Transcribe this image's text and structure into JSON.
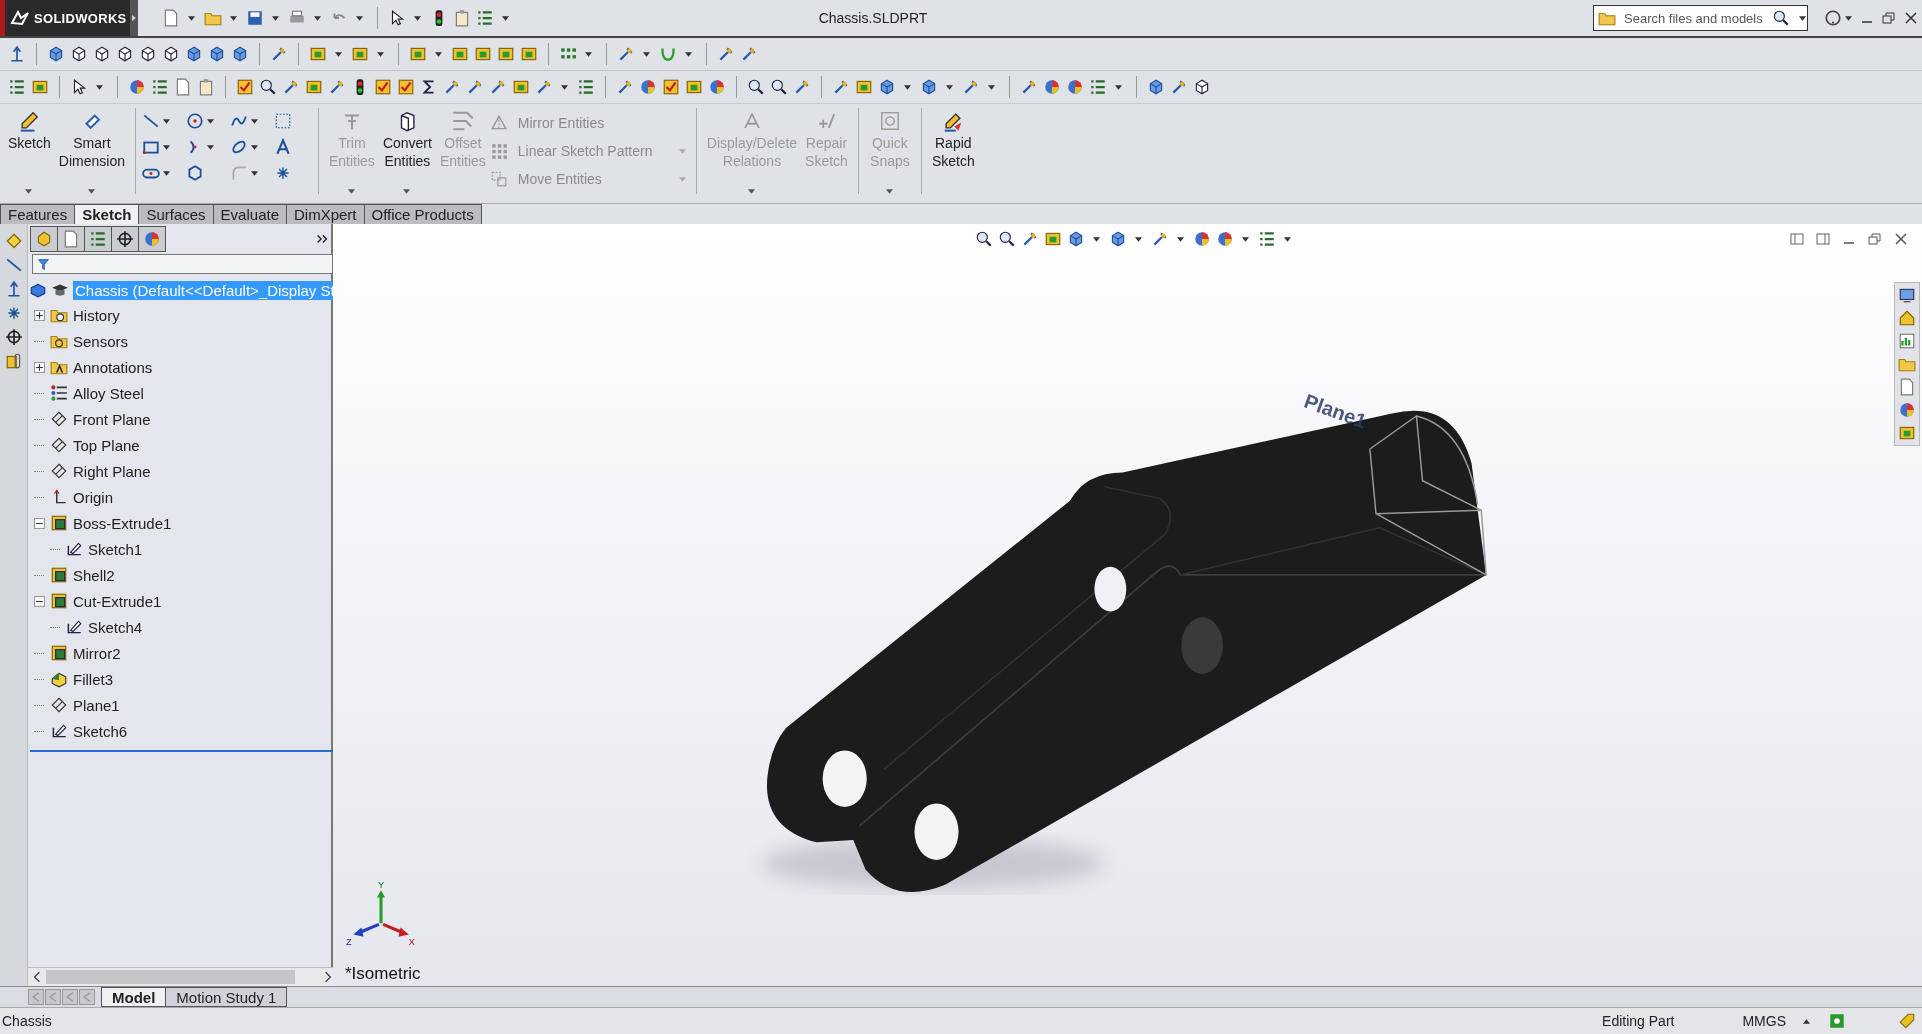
{
  "title_bar": {
    "logo": "SOLIDWORKS",
    "document": "Chassis.SLDPRT",
    "search": {
      "placeholder": "Search files and models"
    }
  },
  "command_groups": [
    {
      "items": [
        {
          "kind": "large",
          "label": "Sketch",
          "disabled": false,
          "dropdown": true
        },
        {
          "kind": "large",
          "label": "Smart Dimension",
          "disabled": false,
          "dropdown": true
        }
      ]
    },
    {
      "items": [
        {
          "kind": "tool_grid"
        }
      ]
    },
    {
      "items": [
        {
          "kind": "large",
          "label": "Trim Entities",
          "disabled": true,
          "dropdown": true
        },
        {
          "kind": "large",
          "label": "Convert Entities",
          "disabled": false,
          "dropdown": true
        },
        {
          "kind": "large",
          "label": "Offset Entities",
          "disabled": true,
          "dropdown": false
        },
        {
          "kind": "stack",
          "items": [
            {
              "label": "Mirror Entities",
              "disabled": true,
              "dropdown": false
            },
            {
              "label": "Linear Sketch Pattern",
              "disabled": true,
              "dropdown": true
            },
            {
              "label": "Move Entities",
              "disabled": true,
              "dropdown": true
            }
          ]
        }
      ]
    },
    {
      "items": [
        {
          "kind": "large",
          "label": "Display/Delete Relations",
          "disabled": true,
          "dropdown": true
        },
        {
          "kind": "large",
          "label": "Repair Sketch",
          "disabled": true,
          "dropdown": false
        }
      ]
    },
    {
      "items": [
        {
          "kind": "large",
          "label": "Quick Snaps",
          "disabled": true,
          "dropdown": true
        }
      ]
    },
    {
      "items": [
        {
          "kind": "large",
          "label": "Rapid Sketch",
          "disabled": false,
          "dropdown": false
        }
      ]
    }
  ],
  "tabs": [
    {
      "label": "Features",
      "selected": false
    },
    {
      "label": "Sketch",
      "selected": true
    },
    {
      "label": "Surfaces",
      "selected": false
    },
    {
      "label": "Evaluate",
      "selected": false
    },
    {
      "label": "DimXpert",
      "selected": false
    },
    {
      "label": "Office Products",
      "selected": false
    }
  ],
  "feature_tree": {
    "root": {
      "label": "Chassis  (Default<<Default>_Display St",
      "selected": true
    },
    "items": [
      {
        "kind": "history",
        "label": "History",
        "expanded": false
      },
      {
        "kind": "sensors",
        "label": "Sensors"
      },
      {
        "kind": "annotations",
        "label": "Annotations",
        "expanded": false
      },
      {
        "kind": "material",
        "label": "Alloy Steel"
      },
      {
        "kind": "plane",
        "label": "Front Plane"
      },
      {
        "kind": "plane",
        "label": "Top Plane"
      },
      {
        "kind": "plane",
        "label": "Right Plane"
      },
      {
        "kind": "origin",
        "label": "Origin"
      },
      {
        "kind": "feature",
        "label": "Boss-Extrude1",
        "expanded": true,
        "children": [
          {
            "kind": "sketch",
            "label": "Sketch1"
          }
        ]
      },
      {
        "kind": "feature",
        "label": "Shell2"
      },
      {
        "kind": "feature",
        "label": "Cut-Extrude1",
        "expanded": true,
        "children": [
          {
            "kind": "sketch",
            "label": "Sketch4"
          }
        ]
      },
      {
        "kind": "feature",
        "label": "Mirror2"
      },
      {
        "kind": "fillet",
        "label": "Fillet3"
      },
      {
        "kind": "plane",
        "label": "Plane1"
      },
      {
        "kind": "sketch",
        "label": "Sketch6"
      }
    ]
  },
  "viewport": {
    "plane_label": "Plane1",
    "view_label": "*Isometric",
    "axes": {
      "x": "X",
      "y": "Y",
      "z": "Z"
    }
  },
  "bottom_tabs": [
    {
      "label": "Model",
      "selected": true
    },
    {
      "label": "Motion Study 1",
      "selected": false
    }
  ],
  "status_bar": {
    "document": "Chassis",
    "mode": "Editing Part",
    "units": "MMGS"
  }
}
